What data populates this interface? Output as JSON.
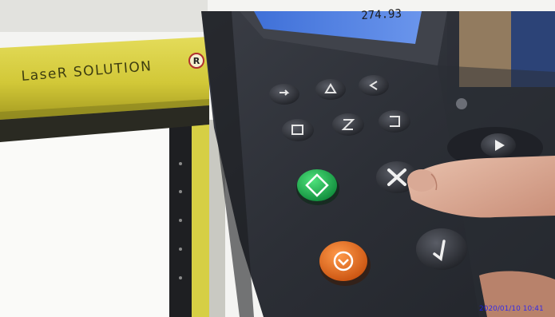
{
  "scene": {
    "brand_label": "LaseR SOLUTION",
    "registered_mark": "R",
    "lcd_value": "274.93",
    "timestamp": "2020/01/10 10:41"
  },
  "keypad": {
    "buttons": [
      {
        "name": "arrow-key-1",
        "icon": "arrow-icon"
      },
      {
        "name": "arrow-key-2",
        "icon": "triangle-icon"
      },
      {
        "name": "arrow-key-3",
        "icon": "arrow-icon"
      },
      {
        "name": "function-key-1",
        "icon": "function-icon"
      },
      {
        "name": "function-key-2",
        "icon": "function-icon"
      },
      {
        "name": "function-key-3",
        "icon": "function-icon"
      },
      {
        "name": "start-button",
        "icon": "diamond-icon",
        "color": "#1aa84a"
      },
      {
        "name": "cancel-button",
        "icon": "close-icon"
      },
      {
        "name": "stop-button",
        "icon": "stop-icon",
        "color": "#e8661f"
      },
      {
        "name": "confirm-button",
        "icon": "check-icon"
      },
      {
        "name": "direction-button",
        "icon": "play-icon"
      }
    ]
  },
  "colors": {
    "laser_rail": "#d8d03a",
    "control_panel": "#2b2e36",
    "lcd_screen": "#4a7be0"
  }
}
